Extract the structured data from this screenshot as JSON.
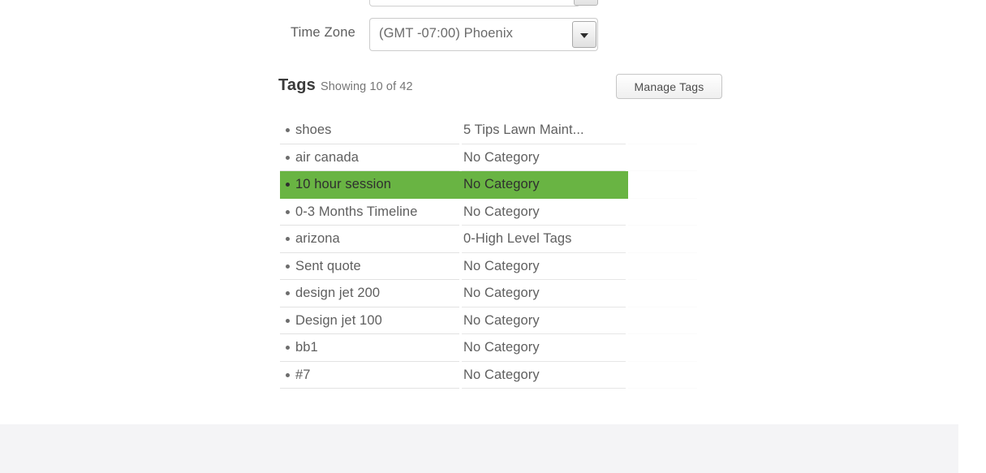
{
  "form": {
    "timezone": {
      "label": "Time Zone",
      "value": "(GMT -07:00) Phoenix",
      "arrow_icon": "chevron-down-icon"
    }
  },
  "tags_section": {
    "title": "Tags",
    "count_text": "Showing 10 of 42",
    "manage_button_label": "Manage Tags",
    "selected_index": 2,
    "highlight_color": "#69b443",
    "rows": [
      {
        "name": "shoes",
        "category": "5 Tips Lawn Maint...",
        "extra": ""
      },
      {
        "name": "air canada",
        "category": "No Category",
        "extra": ""
      },
      {
        "name": "10 hour session",
        "category": "No Category",
        "extra": ""
      },
      {
        "name": "0-3 Months Timeline",
        "category": "No Category",
        "extra": ""
      },
      {
        "name": "arizona",
        "category": "0-High Level Tags",
        "extra": ""
      },
      {
        "name": "Sent quote",
        "category": "No Category",
        "extra": ""
      },
      {
        "name": "design jet 200",
        "category": "No Category",
        "extra": ""
      },
      {
        "name": "Design jet 100",
        "category": "No Category",
        "extra": ""
      },
      {
        "name": "bb1",
        "category": "No Category",
        "extra": ""
      },
      {
        "name": "#7",
        "category": "No Category",
        "extra": ""
      }
    ]
  }
}
